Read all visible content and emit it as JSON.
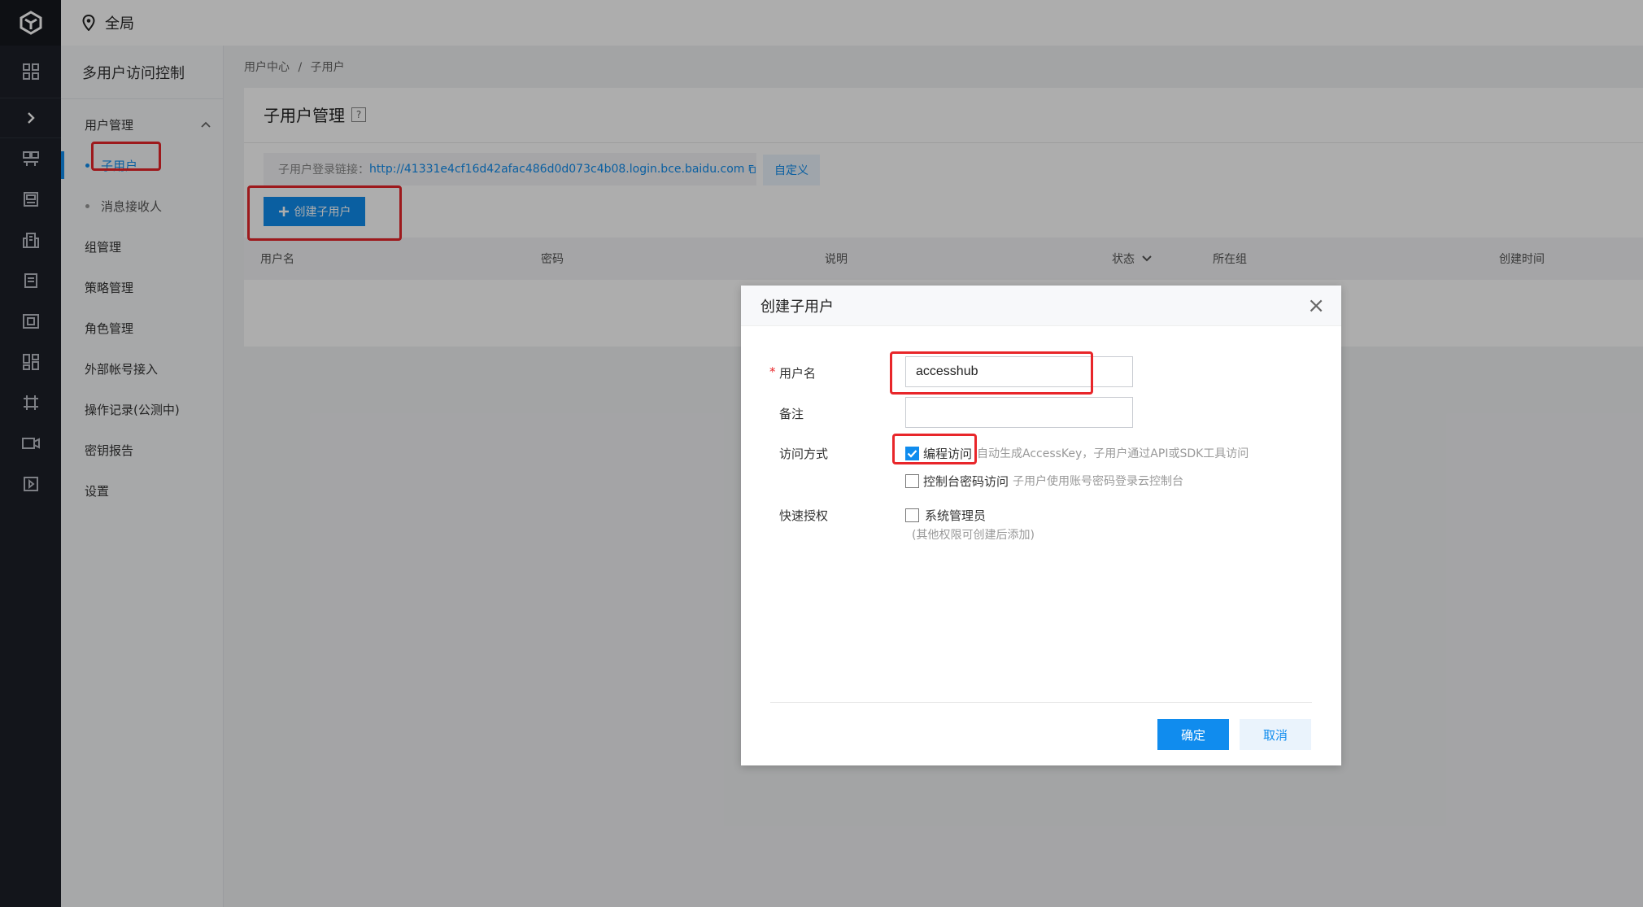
{
  "region": {
    "label": "全局"
  },
  "sidebar": {
    "title": "多用户访问控制",
    "group": {
      "label": "用户管理"
    },
    "sub_items": [
      {
        "label": "子用户"
      },
      {
        "label": "消息接收人"
      }
    ],
    "items": [
      {
        "label": "组管理"
      },
      {
        "label": "策略管理"
      },
      {
        "label": "角色管理"
      },
      {
        "label": "外部帐号接入"
      },
      {
        "label": "操作记录(公测中)"
      },
      {
        "label": "密钥报告"
      },
      {
        "label": "设置"
      }
    ]
  },
  "breadcrumb": {
    "root": "用户中心",
    "sep": "/",
    "current": "子用户"
  },
  "page": {
    "title": "子用户管理",
    "help": "?",
    "login_label": "子用户登录链接：",
    "login_url": "http://41331e4cf16d42afac486d0d073c4b08.login.bce.baidu.com",
    "customize_label": "自定义",
    "create_label": "创建子用户"
  },
  "table": {
    "columns": [
      "用户名",
      "密码",
      "说明",
      "状态",
      "所在组",
      "创建时间"
    ]
  },
  "dialog": {
    "title": "创建子用户",
    "username_label": "用户名",
    "username_value": "accesshub",
    "remark_label": "备注",
    "remark_value": "",
    "access_label": "访问方式",
    "access_programmatic": "编程访问",
    "access_programmatic_hint": "自动生成AccessKey，子用户通过API或SDK工具访问",
    "access_console": "控制台密码访问",
    "access_console_hint": "子用户使用账号密码登录云控制台",
    "quick_label": "快速授权",
    "quick_admin": "系统管理员",
    "quick_hint": "(其他权限可创建后添加)",
    "ok_label": "确定",
    "cancel_label": "取消"
  },
  "colors": {
    "accent": "#108cee",
    "highlight": "#e8262a"
  }
}
